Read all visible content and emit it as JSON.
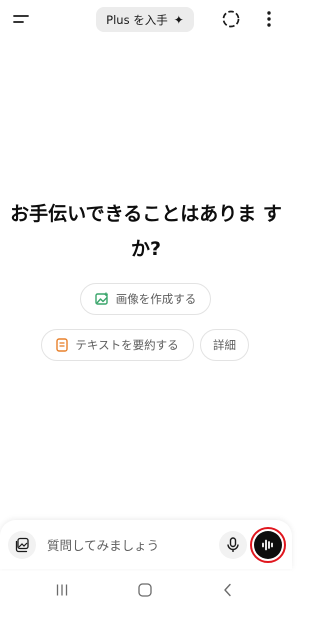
{
  "header": {
    "plus_label": "Plus を入手",
    "plus_icon": "sparkle-icon",
    "menu_icon": "menu-icon",
    "temp_chat_icon": "temporary-chat-icon",
    "more_icon": "more-vertical-icon"
  },
  "main": {
    "heading_line1": "お手伝いできることはありま す",
    "heading_line2": "か?"
  },
  "suggestions": [
    {
      "label": "画像を作成する",
      "icon": "image-create-icon",
      "icon_color": "#3aa56b"
    },
    {
      "label": "テキストを要約する",
      "icon": "document-icon",
      "icon_color": "#e8802b"
    },
    {
      "label": "詳細"
    }
  ],
  "composer": {
    "placeholder": "質問してみましょう",
    "attach_icon": "attach-photo-icon",
    "mic_icon": "microphone-icon",
    "voice_icon": "voice-mode-icon",
    "highlight_color": "#e0161e"
  },
  "system_nav": {
    "recent_icon": "recent-apps-icon",
    "home_icon": "home-icon",
    "back_icon": "back-icon"
  }
}
